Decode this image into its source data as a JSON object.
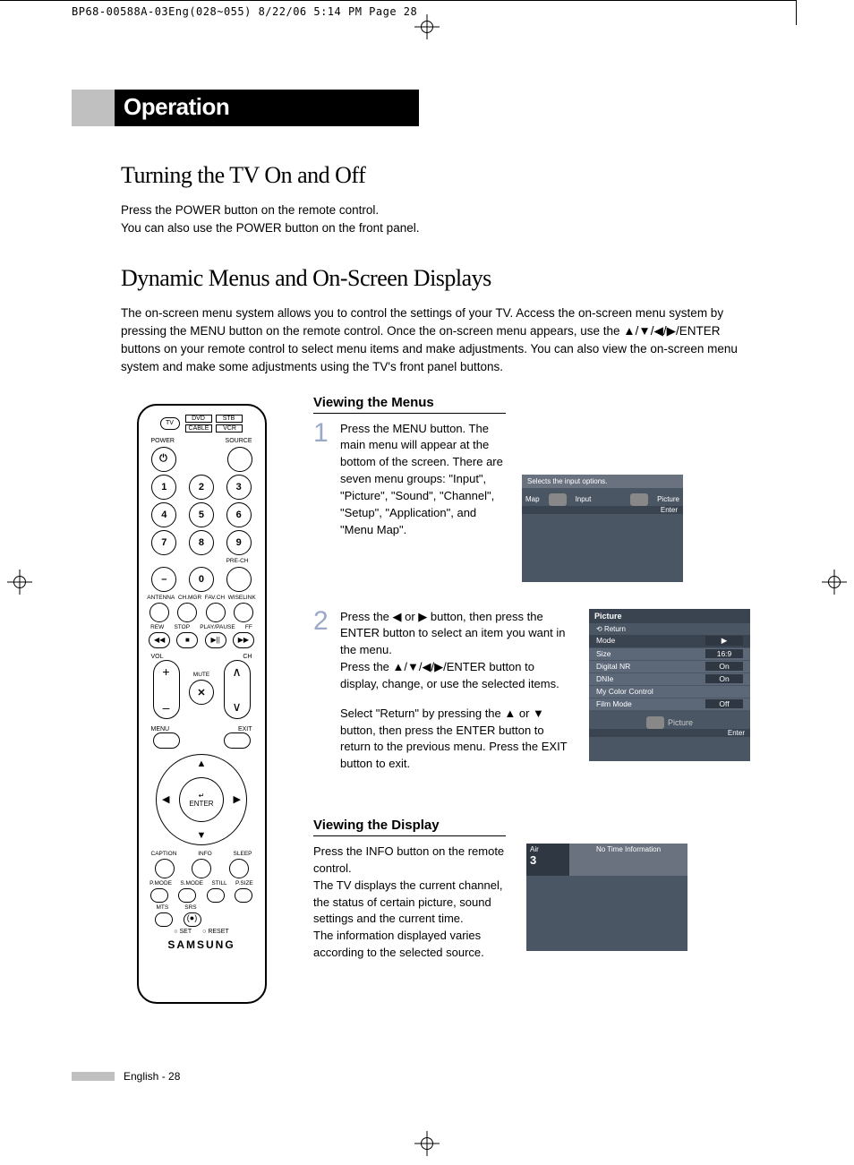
{
  "crop_header": "BP68-00588A-03Eng(028~055)  8/22/06  5:14 PM  Page 28",
  "heading": "Operation",
  "section1": {
    "title": "Turning the TV On and Off",
    "p1": "Press the POWER button on the remote control.",
    "p2": "You can also use the POWER button on the front panel."
  },
  "section2": {
    "title": "Dynamic Menus and On-Screen Displays",
    "intro": "The on-screen menu system allows you to control the settings of your TV. Access the on-screen menu system by pressing the MENU button on the remote control. Once the on-screen menu appears, use the ▲/▼/◀/▶/ENTER buttons on your remote control to select menu items and make adjustments. You can also view the on-screen menu system and make some adjustments using the TV's front panel buttons."
  },
  "viewing_menus": {
    "heading": "Viewing the Menus",
    "step1_num": "1",
    "step1": "Press the MENU button. The main menu will appear at the bottom of the screen. There are seven menu groups: \"Input\", \"Picture\", \"Sound\", \"Channel\", \"Setup\", \"Application\", and \"Menu Map\".",
    "step2_num": "2",
    "step2a": "Press the ◀ or ▶ button, then press the ENTER button to select an item you want in the menu.",
    "step2b": "Press the ▲/▼/◀/▶/ENTER button to display, change, or use the selected items.",
    "step2c": "Select \"Return\" by pressing the ▲ or ▼ button, then press the ENTER button to return to the previous menu. Press the EXIT button to exit."
  },
  "viewing_display": {
    "heading": "Viewing the Display",
    "p1": "Press the INFO button on the remote control.",
    "p2": "The TV displays the current channel, the status of certain picture, sound settings and the current time.",
    "p3": "The information displayed varies according to the selected source."
  },
  "remote": {
    "tv": "TV",
    "modes": {
      "dvd": "DVD",
      "stb": "STB",
      "cable": "CABLE",
      "vcr": "VCR"
    },
    "power": "POWER",
    "source": "SOURCE",
    "nums": [
      "1",
      "2",
      "3",
      "4",
      "5",
      "6",
      "7",
      "8",
      "9",
      "0"
    ],
    "dash": "–",
    "pre_ch": "PRE-CH",
    "row_labels": {
      "antenna": "ANTENNA",
      "chmgr": "CH.MGR",
      "favch": "FAV.CH",
      "wiselink": "WISELINK"
    },
    "transport": {
      "rew": "REW",
      "stop": "STOP",
      "play": "PLAY/PAUSE",
      "ff": "FF"
    },
    "vol": "VOL",
    "ch": "CH",
    "plus": "+",
    "minus": "–",
    "up": "∧",
    "down": "∨",
    "mute": "MUTE",
    "menu": "MENU",
    "exit": "EXIT",
    "enter": "ENTER",
    "enter_icon": "↵",
    "arrows": {
      "u": "▲",
      "d": "▼",
      "l": "◀",
      "r": "▶"
    },
    "caption": "CAPTION",
    "info": "INFO",
    "sleep": "SLEEP",
    "pmode": "P.MODE",
    "smode": "S.MODE",
    "still": "STILL",
    "psize": "P.SIZE",
    "mts": "MTS",
    "srs": "SRS",
    "set": "SET",
    "reset": "RESET",
    "brand": "SAMSUNG"
  },
  "osd1": {
    "hint": "Selects the input options.",
    "tab_left": "Map",
    "tab_mid": "Input",
    "tab_right": "Picture",
    "enter": "Enter"
  },
  "osd2": {
    "title": "Picture",
    "return": "Return",
    "rows": [
      {
        "label": "Mode",
        "value": "▶"
      },
      {
        "label": "Size",
        "value": "16:9"
      },
      {
        "label": "Digital NR",
        "value": "On"
      },
      {
        "label": "DNIe",
        "value": "On"
      },
      {
        "label": "My Color Control",
        "value": ""
      },
      {
        "label": "Film Mode",
        "value": "Off"
      }
    ],
    "category": "Picture",
    "enter": "Enter"
  },
  "osd3": {
    "no_time": "No Time Information",
    "air": "Air",
    "ch": "3"
  },
  "footer": "English - 28"
}
